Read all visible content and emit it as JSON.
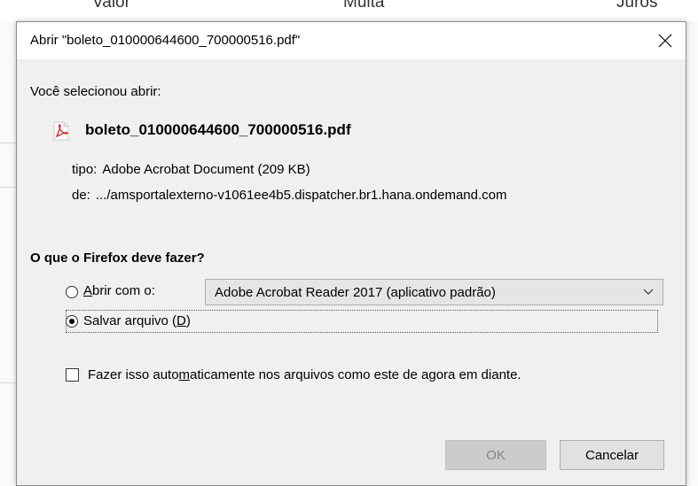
{
  "background": {
    "col_valor": "Valor",
    "col_multa": "Multa",
    "col_juros": "Juros"
  },
  "dialog": {
    "title": "Abrir \"boleto_010000644600_700000516.pdf\"",
    "intro": "Você selecionou abrir:",
    "file_icon": "pdf-file-icon",
    "filename": "boleto_010000644600_700000516.pdf",
    "type_key": "tipo:",
    "type_value": "Adobe Acrobat Document (209 KB)",
    "from_key": "de:",
    "from_value": ".../amsportalexterno-v1061ee4b5.dispatcher.br1.hana.ondemand.com",
    "question": "O que o Firefox deve fazer?",
    "open_with_pre": "",
    "open_with_u": "A",
    "open_with_post": "brir com o:",
    "open_with_selected": "Adobe Acrobat Reader 2017  (aplicativo padrão)",
    "save_pre": "Salvar arquivo (",
    "save_u": "D",
    "save_post": ")",
    "auto_pre": "Fazer isso auto",
    "auto_u": "m",
    "auto_post": "aticamente nos arquivos como este de agora em diante.",
    "ok_label": "OK",
    "cancel_label": "Cancelar",
    "selected_option": "save",
    "auto_checked": false
  }
}
